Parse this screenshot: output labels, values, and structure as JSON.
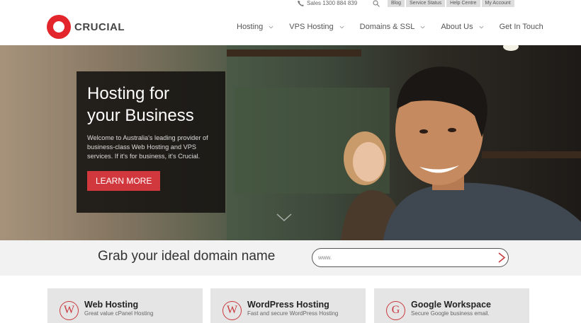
{
  "topbar": {
    "sales": "Sales 1300 884 839",
    "links": [
      "Blog",
      "Service Status",
      "Help Centre",
      "My Account"
    ]
  },
  "nav": {
    "brand": "CRUCIAL",
    "items": [
      "Hosting",
      "VPS Hosting",
      "Domains & SSL",
      "About Us",
      "Get In Touch"
    ]
  },
  "hero": {
    "title_line1": "Hosting for",
    "title_line2": "your Business",
    "description": "Welcome to Australia's leading provider of business-class Web Hosting and VPS services. If it's for business, it's Crucial.",
    "button": "LEARN MORE"
  },
  "domain": {
    "title": "Grab your ideal domain name",
    "placeholder": "www."
  },
  "cards": [
    {
      "icon": "W",
      "title": "Web Hosting",
      "subtitle": "Great value cPanel Hosting"
    },
    {
      "icon": "W",
      "title": "WordPress Hosting",
      "subtitle": "Fast and secure WordPress Hosting"
    },
    {
      "icon": "G",
      "title": "Google Workspace",
      "subtitle": "Secure Google business email."
    }
  ],
  "colors": {
    "brand_red": "#e2262c",
    "button_red": "#d0383e"
  }
}
